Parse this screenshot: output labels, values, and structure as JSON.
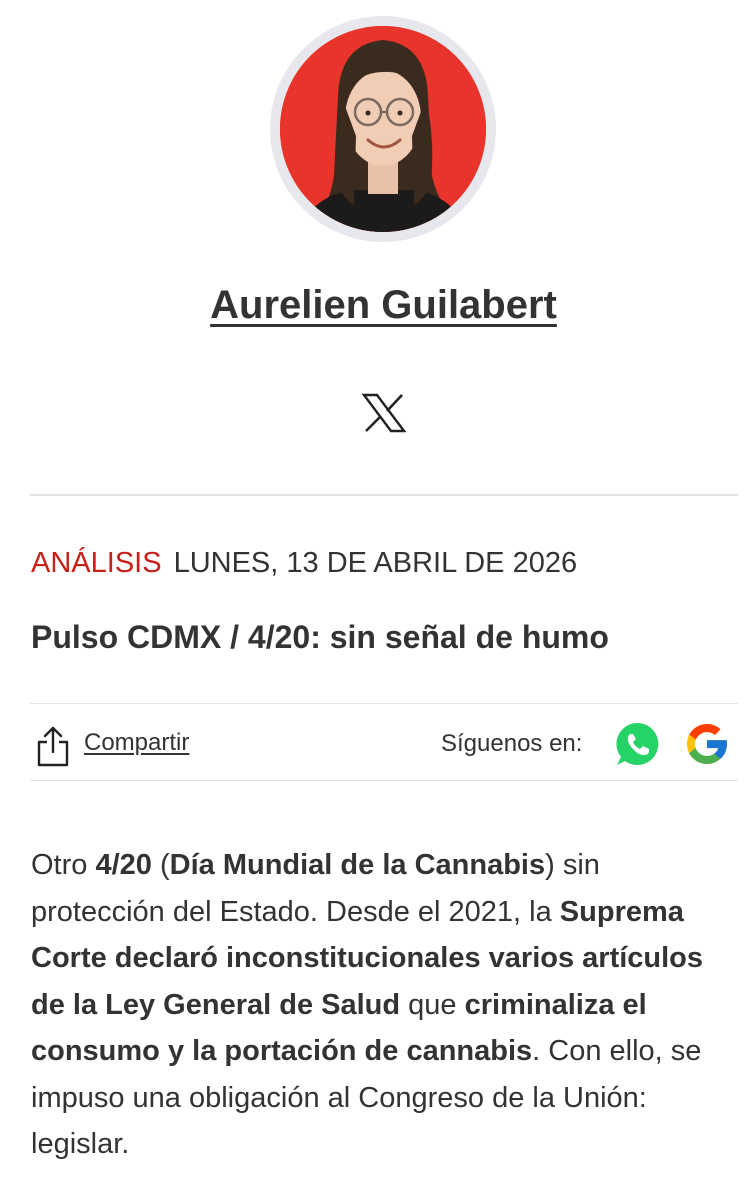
{
  "author": {
    "name": "Aurelien Guilabert",
    "social_icon": "x-logo-icon",
    "avatar_bg_color": "#e8342b"
  },
  "article": {
    "section": "ANÁLISIS",
    "date": "LUNES, 13 DE ABRIL DE 2026",
    "title": "Pulso CDMX / 4/20: sin señal de humo",
    "accent_color": "#c8211a"
  },
  "toolbar": {
    "share_label": "Compartir",
    "follow_label": "Síguenos en:",
    "follow_icons": [
      "whatsapp-icon",
      "google-icon"
    ]
  },
  "body": {
    "p1": [
      "Otro ",
      "4/20",
      " (",
      "Día Mundial de la Cannabis",
      ") sin protección del Estado. Desde el 2021, la ",
      "Suprema Corte declaró inconstitucionales varios artículos de la Ley General de Salud",
      " que ",
      "criminaliza el consumo y la portación de cannabis",
      ". Con ello, se impuso una obligación al Congreso de la Unión: legislar."
    ]
  }
}
